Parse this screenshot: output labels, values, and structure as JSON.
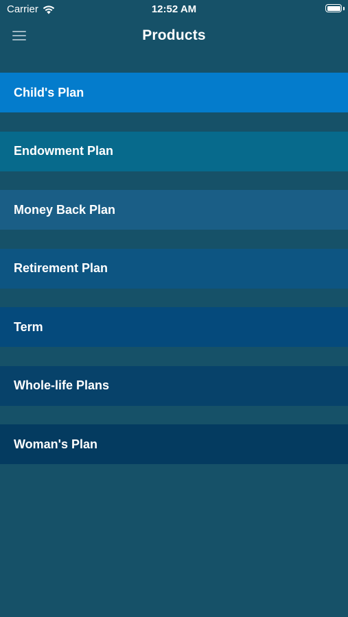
{
  "status_bar": {
    "carrier": "Carrier",
    "time": "12:52 AM",
    "wifi_icon": "wifi-icon",
    "battery_icon": "battery-icon"
  },
  "nav": {
    "title": "Products",
    "menu_icon": "hamburger-menu-icon"
  },
  "colors": {
    "background": "#165168"
  },
  "products": [
    {
      "label": "Child's Plan",
      "color": "#047ccc"
    },
    {
      "label": "Endowment Plan",
      "color": "#076a8c"
    },
    {
      "label": "Money Back Plan",
      "color": "#1a5e86"
    },
    {
      "label": "Retirement Plan",
      "color": "#0d5582"
    },
    {
      "label": "Term",
      "color": "#054a7c"
    },
    {
      "label": "Whole-life Plans",
      "color": "#07426a"
    },
    {
      "label": "Woman's Plan",
      "color": "#043b60"
    }
  ]
}
